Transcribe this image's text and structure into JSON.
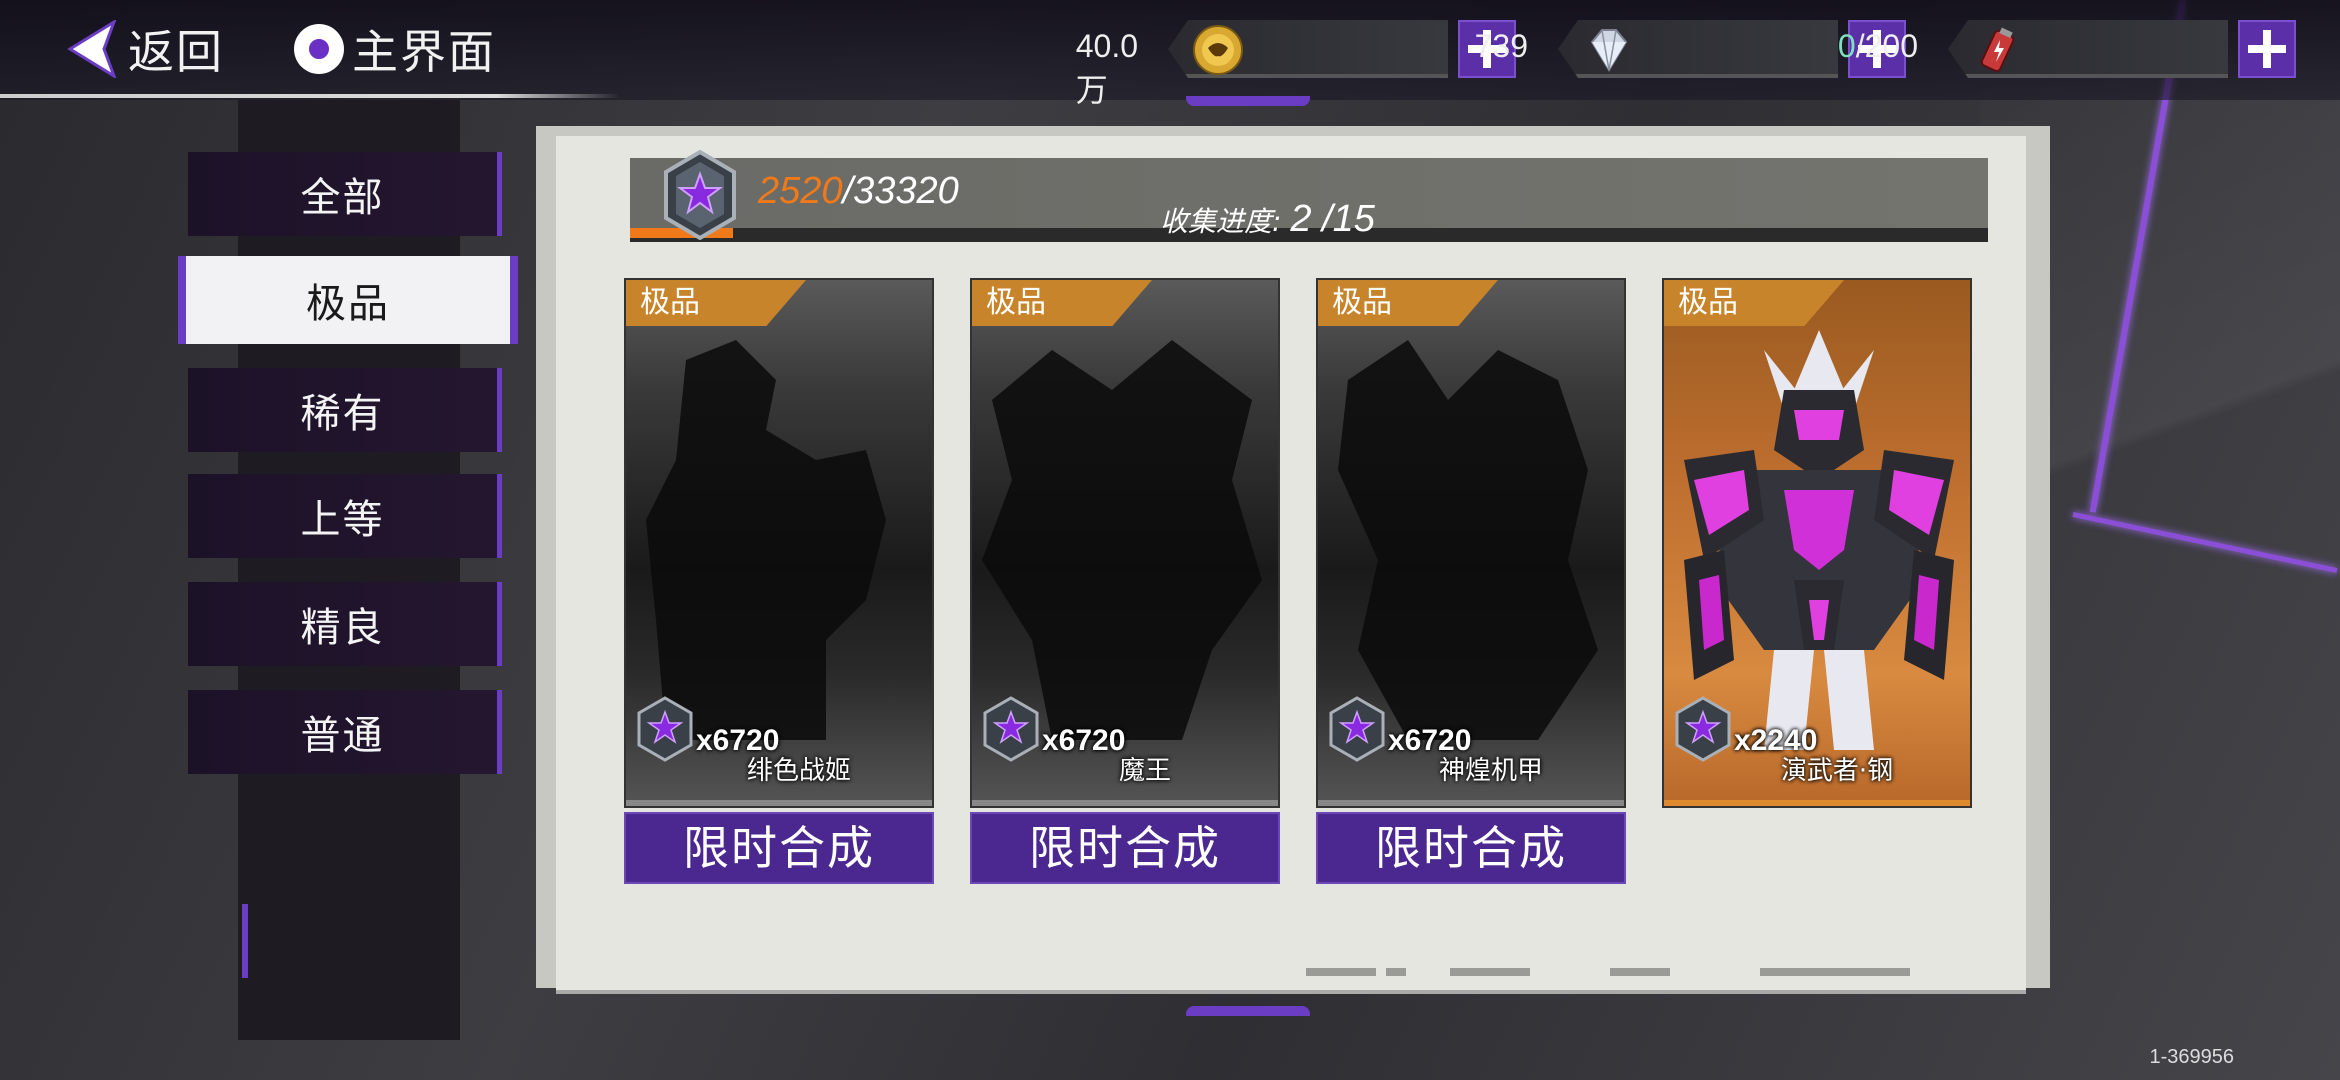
{
  "nav": {
    "back_label": "返回",
    "home_label": "主界面"
  },
  "currencies": [
    {
      "icon": "gold-coin-icon",
      "value": "40.0万"
    },
    {
      "icon": "diamond-icon",
      "value": "739"
    },
    {
      "icon": "energy-canister-icon",
      "value_current": "0",
      "value_max": "/200"
    }
  ],
  "sidebar": {
    "tabs": [
      {
        "label": "全部",
        "active": false
      },
      {
        "label": "极品",
        "active": true
      },
      {
        "label": "稀有",
        "active": false
      },
      {
        "label": "上等",
        "active": false
      },
      {
        "label": "精良",
        "active": false
      },
      {
        "label": "普通",
        "active": false
      }
    ]
  },
  "collection": {
    "score_current": "2520",
    "score_total": "/33320",
    "score_fraction": 0.0756,
    "progress_label": "收集进度:",
    "progress_value": "2 /15"
  },
  "cards": [
    {
      "tag": "极品",
      "count": "x6720",
      "name": "绯色战姬",
      "owned": false,
      "button": "限时合成"
    },
    {
      "tag": "极品",
      "count": "x6720",
      "name": "魔王",
      "owned": false,
      "button": "限时合成"
    },
    {
      "tag": "极品",
      "count": "x6720",
      "name": "神煌机甲",
      "owned": false,
      "button": "限时合成"
    },
    {
      "tag": "极品",
      "count": "x2240",
      "name": "演武者·钢",
      "owned": true
    }
  ],
  "footer": {
    "id": "1-369956"
  },
  "colors": {
    "accent_purple": "#6a3dc4",
    "accent_orange": "#f07a1a",
    "energy_current": "#7fe0c0"
  }
}
